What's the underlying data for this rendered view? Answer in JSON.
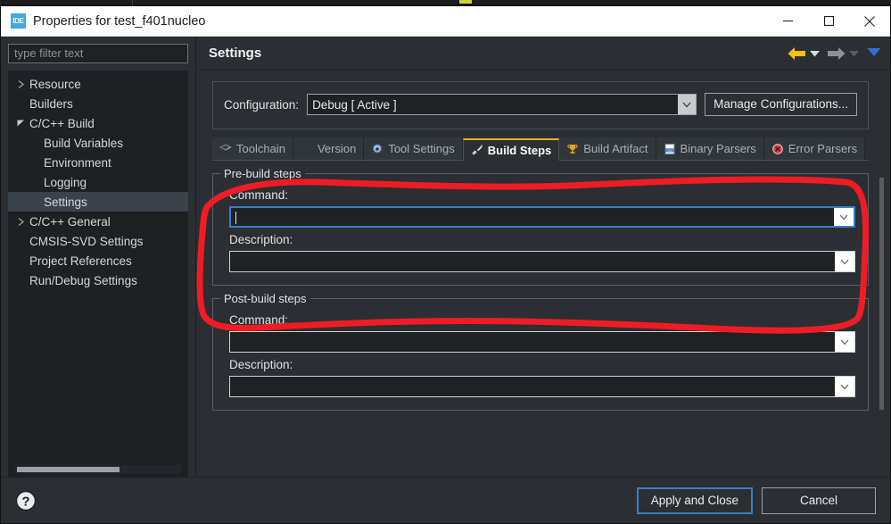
{
  "window": {
    "title": "Properties for test_f401nucleo",
    "app_icon": "ide-icon",
    "icon_text": "IDE",
    "controls": {
      "minimize": "—",
      "maximize": "☐",
      "close": "✕"
    }
  },
  "sidebar": {
    "filter": {
      "value": "",
      "placeholder": "type filter text"
    },
    "items": [
      {
        "label": "Resource",
        "level": 1,
        "twisty": "collapsed",
        "selected": false
      },
      {
        "label": "Builders",
        "level": 1,
        "twisty": "none",
        "selected": false
      },
      {
        "label": "C/C++ Build",
        "level": 1,
        "twisty": "expanded",
        "selected": false
      },
      {
        "label": "Build Variables",
        "level": 2,
        "twisty": "none",
        "selected": false
      },
      {
        "label": "Environment",
        "level": 2,
        "twisty": "none",
        "selected": false
      },
      {
        "label": "Logging",
        "level": 2,
        "twisty": "none",
        "selected": false
      },
      {
        "label": "Settings",
        "level": 2,
        "twisty": "none",
        "selected": true
      },
      {
        "label": "C/C++ General",
        "level": 1,
        "twisty": "collapsed",
        "selected": false
      },
      {
        "label": "CMSIS-SVD Settings",
        "level": 1,
        "twisty": "none",
        "selected": false
      },
      {
        "label": "Project References",
        "level": 1,
        "twisty": "none",
        "selected": false
      },
      {
        "label": "Run/Debug Settings",
        "level": 1,
        "twisty": "none",
        "selected": false
      }
    ]
  },
  "header": {
    "title": "Settings",
    "nav": {
      "back": "back-arrow-icon",
      "back_menu": "back-dropdown-icon",
      "forward": "forward-arrow-icon",
      "forward_menu": "forward-dropdown-icon",
      "view_menu": "view-menu-icon"
    }
  },
  "configuration": {
    "label": "Configuration:",
    "value": "Debug  [ Active ]",
    "manage_button": "Manage Configurations..."
  },
  "tabs": [
    {
      "label": "Toolchain",
      "icon": "toolchain-icon",
      "active": false
    },
    {
      "label": "Version",
      "icon": "version-icon",
      "active": false
    },
    {
      "label": "Tool Settings",
      "icon": "tool-settings-icon",
      "active": false
    },
    {
      "label": "Build Steps",
      "icon": "build-steps-icon",
      "active": true
    },
    {
      "label": "Build Artifact",
      "icon": "trophy-icon",
      "active": false
    },
    {
      "label": "Binary Parsers",
      "icon": "binary-parsers-icon",
      "active": false
    },
    {
      "label": "Error Parsers",
      "icon": "error-parsers-icon",
      "active": false
    }
  ],
  "prebuild": {
    "title": "Pre-build steps",
    "command_label": "Command:",
    "command_value": "",
    "description_label": "Description:",
    "description_value": ""
  },
  "postbuild": {
    "title": "Post-build steps",
    "command_label": "Command:",
    "command_value": "",
    "description_label": "Description:",
    "description_value": ""
  },
  "footer": {
    "help": "help-icon",
    "apply_and_close": "Apply and Close",
    "cancel": "Cancel"
  },
  "annotation": {
    "kind": "hand-drawn-highlight-loop",
    "color": "#ee1c25",
    "target": "Pre-build steps"
  },
  "colors": {
    "accent_blue": "#3a7fc4",
    "active_tab_underline": "#e8b21e",
    "annotation_red": "#ee1c25",
    "window_chrome": "#2b2f33",
    "titlebar": "#ffffff"
  }
}
